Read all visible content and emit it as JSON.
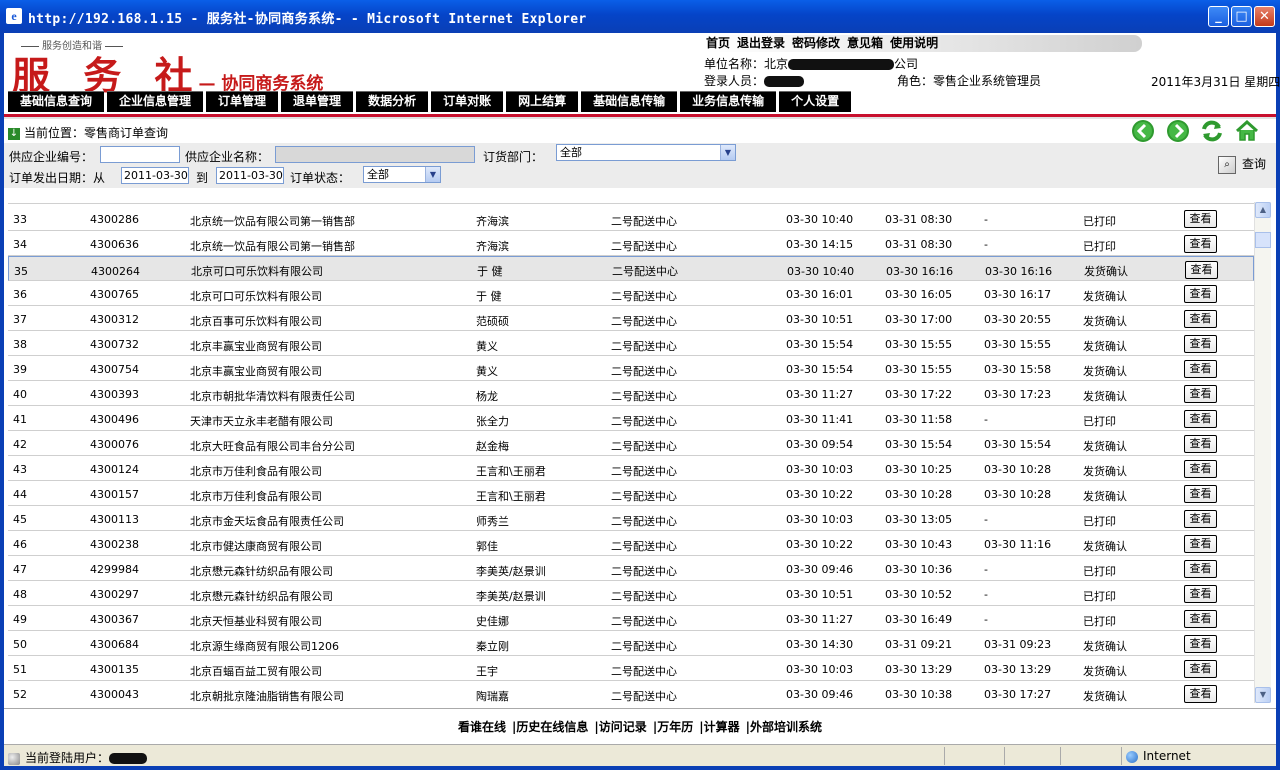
{
  "window": {
    "title": "http://192.168.1.15 - 服务社-协同商务系统-       - Microsoft Internet Explorer"
  },
  "header": {
    "slogan": "服务创造和谐",
    "logo_main": "服 务 社",
    "logo_sub": "— 协同商务系统",
    "links": [
      "首页",
      "退出登录",
      "密码修改",
      "意见箱",
      "使用说明"
    ],
    "unit_label": "单位名称：北京",
    "unit_suffix": "公司",
    "user_label": "登录人员：",
    "role": "角色：零售企业系统管理员",
    "date": "2011年3月31日 星期四"
  },
  "nav": [
    "基础信息查询",
    "企业信息管理",
    "订单管理",
    "退单管理",
    "数据分析",
    "订单对账",
    "网上结算",
    "基础信息传输",
    "业务信息传输",
    "个人设置"
  ],
  "breadcrumb": "当前位置：零售商订单查询",
  "filters": {
    "supplier_code_label": "供应企业编号：",
    "supplier_code_value": "",
    "supplier_name_label": "供应企业名称：",
    "supplier_name_value": "",
    "dept_label": "订货部门：",
    "dept_value": "全部",
    "date_label": "订单发出日期：从",
    "date_from": "2011-03-30",
    "to_label": "到",
    "date_to": "2011-03-30",
    "status_label": "订单状态：",
    "status_value": "全部",
    "query_label": "查询"
  },
  "rows": [
    {
      "no": "33",
      "order": "4300286",
      "supplier": "北京统一饮品有限公司第一销售部",
      "contact": "齐海滨",
      "dept": "二号配送中心",
      "t1": "03-30 10:40",
      "t2": "03-31 08:30",
      "t3": "-",
      "status": "已打印"
    },
    {
      "no": "34",
      "order": "4300636",
      "supplier": "北京统一饮品有限公司第一销售部",
      "contact": "齐海滨",
      "dept": "二号配送中心",
      "t1": "03-30 14:15",
      "t2": "03-31 08:30",
      "t3": "-",
      "status": "已打印"
    },
    {
      "no": "35",
      "order": "4300264",
      "supplier": "北京可口可乐饮料有限公司",
      "contact": "于 健",
      "dept": "二号配送中心",
      "t1": "03-30 10:40",
      "t2": "03-30 16:16",
      "t3": "03-30 16:16",
      "status": "发货确认"
    },
    {
      "no": "36",
      "order": "4300765",
      "supplier": "北京可口可乐饮料有限公司",
      "contact": "于 健",
      "dept": "二号配送中心",
      "t1": "03-30 16:01",
      "t2": "03-30 16:05",
      "t3": "03-30 16:17",
      "status": "发货确认"
    },
    {
      "no": "37",
      "order": "4300312",
      "supplier": "北京百事可乐饮料有限公司",
      "contact": "范硕硕",
      "dept": "二号配送中心",
      "t1": "03-30 10:51",
      "t2": "03-30 17:00",
      "t3": "03-30 20:55",
      "status": "发货确认"
    },
    {
      "no": "38",
      "order": "4300732",
      "supplier": "北京丰赢宝业商贸有限公司",
      "contact": "黄义",
      "dept": "二号配送中心",
      "t1": "03-30 15:54",
      "t2": "03-30 15:55",
      "t3": "03-30 15:55",
      "status": "发货确认"
    },
    {
      "no": "39",
      "order": "4300754",
      "supplier": "北京丰赢宝业商贸有限公司",
      "contact": "黄义",
      "dept": "二号配送中心",
      "t1": "03-30 15:54",
      "t2": "03-30 15:55",
      "t3": "03-30 15:58",
      "status": "发货确认"
    },
    {
      "no": "40",
      "order": "4300393",
      "supplier": "北京市朝批华清饮料有限责任公司",
      "contact": "杨龙",
      "dept": "二号配送中心",
      "t1": "03-30 11:27",
      "t2": "03-30 17:22",
      "t3": "03-30 17:23",
      "status": "发货确认"
    },
    {
      "no": "41",
      "order": "4300496",
      "supplier": "天津市天立永丰老醋有限公司",
      "contact": "张全力",
      "dept": "二号配送中心",
      "t1": "03-30 11:41",
      "t2": "03-30 11:58",
      "t3": "-",
      "status": "已打印"
    },
    {
      "no": "42",
      "order": "4300076",
      "supplier": "北京大旺食品有限公司丰台分公司",
      "contact": "赵金梅",
      "dept": "二号配送中心",
      "t1": "03-30 09:54",
      "t2": "03-30 15:54",
      "t3": "03-30 15:54",
      "status": "发货确认"
    },
    {
      "no": "43",
      "order": "4300124",
      "supplier": "北京市万佳利食品有限公司",
      "contact": "王言和\\王丽君",
      "dept": "二号配送中心",
      "t1": "03-30 10:03",
      "t2": "03-30 10:25",
      "t3": "03-30 10:28",
      "status": "发货确认"
    },
    {
      "no": "44",
      "order": "4300157",
      "supplier": "北京市万佳利食品有限公司",
      "contact": "王言和\\王丽君",
      "dept": "二号配送中心",
      "t1": "03-30 10:22",
      "t2": "03-30 10:28",
      "t3": "03-30 10:28",
      "status": "发货确认"
    },
    {
      "no": "45",
      "order": "4300113",
      "supplier": "北京市金天坛食品有限责任公司",
      "contact": "师秀兰",
      "dept": "二号配送中心",
      "t1": "03-30 10:03",
      "t2": "03-30 13:05",
      "t3": "-",
      "status": "已打印"
    },
    {
      "no": "46",
      "order": "4300238",
      "supplier": "北京市健达康商贸有限公司",
      "contact": "郭佳",
      "dept": "二号配送中心",
      "t1": "03-30 10:22",
      "t2": "03-30 10:43",
      "t3": "03-30 11:16",
      "status": "发货确认"
    },
    {
      "no": "47",
      "order": "4299984",
      "supplier": "北京懋元森针纺织品有限公司",
      "contact": "李美英/赵景训",
      "dept": "二号配送中心",
      "t1": "03-30 09:46",
      "t2": "03-30 10:36",
      "t3": "-",
      "status": "已打印"
    },
    {
      "no": "48",
      "order": "4300297",
      "supplier": "北京懋元森针纺织品有限公司",
      "contact": "李美英/赵景训",
      "dept": "二号配送中心",
      "t1": "03-30 10:51",
      "t2": "03-30 10:52",
      "t3": "-",
      "status": "已打印"
    },
    {
      "no": "49",
      "order": "4300367",
      "supplier": "北京天恒基业科贸有限公司",
      "contact": "史佳娜",
      "dept": "二号配送中心",
      "t1": "03-30 11:27",
      "t2": "03-30 16:49",
      "t3": "-",
      "status": "已打印"
    },
    {
      "no": "50",
      "order": "4300684",
      "supplier": "北京源生缘商贸有限公司1206",
      "contact": "秦立刚",
      "dept": "二号配送中心",
      "t1": "03-30 14:30",
      "t2": "03-31 09:21",
      "t3": "03-31 09:23",
      "status": "发货确认"
    },
    {
      "no": "51",
      "order": "4300135",
      "supplier": "北京百蝠百益工贸有限公司",
      "contact": "王宇",
      "dept": "二号配送中心",
      "t1": "03-30 10:03",
      "t2": "03-30 13:29",
      "t3": "03-30 13:29",
      "status": "发货确认"
    },
    {
      "no": "52",
      "order": "4300043",
      "supplier": "北京朝批京隆油脂销售有限公司",
      "contact": "陶瑞嘉",
      "dept": "二号配送中心",
      "t1": "03-30 09:46",
      "t2": "03-30 10:38",
      "t3": "03-30 17:27",
      "status": "发货确认"
    }
  ],
  "view_label": "查看",
  "selected_row": "35",
  "footer": [
    "看谁在线",
    "|历史在线信息",
    "|访问记录",
    "|万年历",
    "|计算器",
    "|外部培训系统"
  ],
  "status": {
    "current_user_label": "当前登陆用户：",
    "zone": "Internet"
  },
  "colors": {
    "title_bar": "#0544c8",
    "nav_bg": "#000000",
    "accent_red": "#c8102e",
    "logo_red": "#c61a1a",
    "selected_row": "#e6e6e6"
  },
  "icons": {
    "back": "back-icon",
    "forward": "forward-icon",
    "refresh": "refresh-icon",
    "home": "home-icon"
  }
}
